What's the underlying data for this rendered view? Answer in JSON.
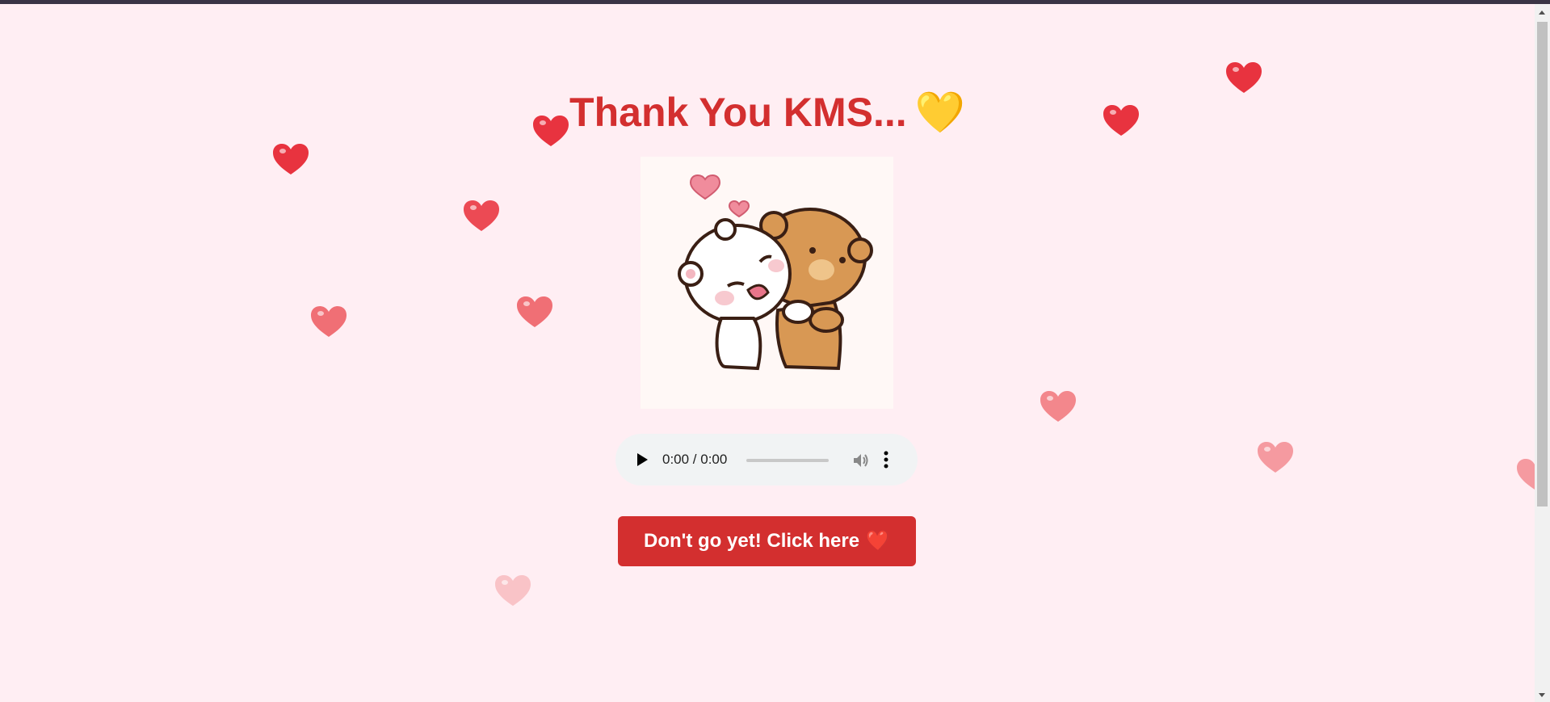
{
  "page": {
    "title": "Thank You KMS...",
    "title_emoji": "💛",
    "background_color": "#ffeef3",
    "accent_color": "#d32f2f"
  },
  "image": {
    "icon": "hugging-bears-icon"
  },
  "audio_player": {
    "time": "0:00 / 0:00",
    "progress": 0,
    "icons": [
      "play-icon",
      "volume-icon",
      "more-options-icon"
    ]
  },
  "cta": {
    "label": "Don't go yet! Click here",
    "emoji": "❤️"
  },
  "floating_hearts": {
    "icon": "heart-icon",
    "colors": [
      "#e8333f",
      "#f06f75",
      "#f59aa0",
      "#f9c3c7"
    ]
  }
}
